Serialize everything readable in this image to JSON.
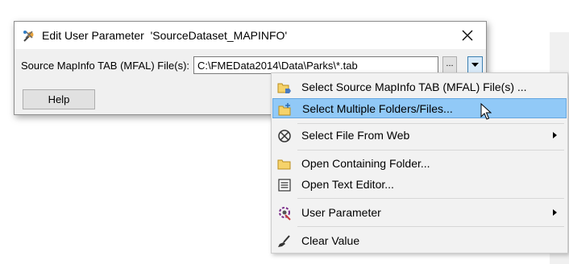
{
  "dialog": {
    "title": "Edit User Parameter  'SourceDataset_MAPINFO'",
    "field_label": "Source MapInfo TAB (MFAL) File(s):",
    "path_value": "C:\\FMEData2014\\Data\\Parks\\*.tab",
    "browse_label": "...",
    "help_label": "Help",
    "icons": {
      "title": "fme-parameter-icon",
      "close": "close-icon",
      "dropdown": "chevron-down-icon"
    }
  },
  "menu": {
    "items": [
      {
        "label": "Select Source MapInfo TAB (MFAL) File(s) ...",
        "icon": "folder-open-icon",
        "submenu": false,
        "highlighted": false
      },
      {
        "label": "Select Multiple Folders/Files...",
        "icon": "folder-add-icon",
        "submenu": false,
        "highlighted": true
      },
      {
        "label": "Select File From Web",
        "icon": "web-icon",
        "submenu": true,
        "highlighted": false
      },
      {
        "label": "Open Containing Folder...",
        "icon": "folder-icon",
        "submenu": false,
        "highlighted": false
      },
      {
        "label": "Open Text Editor...",
        "icon": "text-editor-icon",
        "submenu": false,
        "highlighted": false
      },
      {
        "label": "User Parameter",
        "icon": "user-parameter-icon",
        "submenu": true,
        "highlighted": false
      },
      {
        "label": "Clear Value",
        "icon": "clear-broom-icon",
        "submenu": false,
        "highlighted": false
      }
    ]
  },
  "colors": {
    "menu_highlight": "#91c9f7",
    "menu_bg": "#f2f2f2",
    "dialog_bg": "#f0f0f0"
  }
}
